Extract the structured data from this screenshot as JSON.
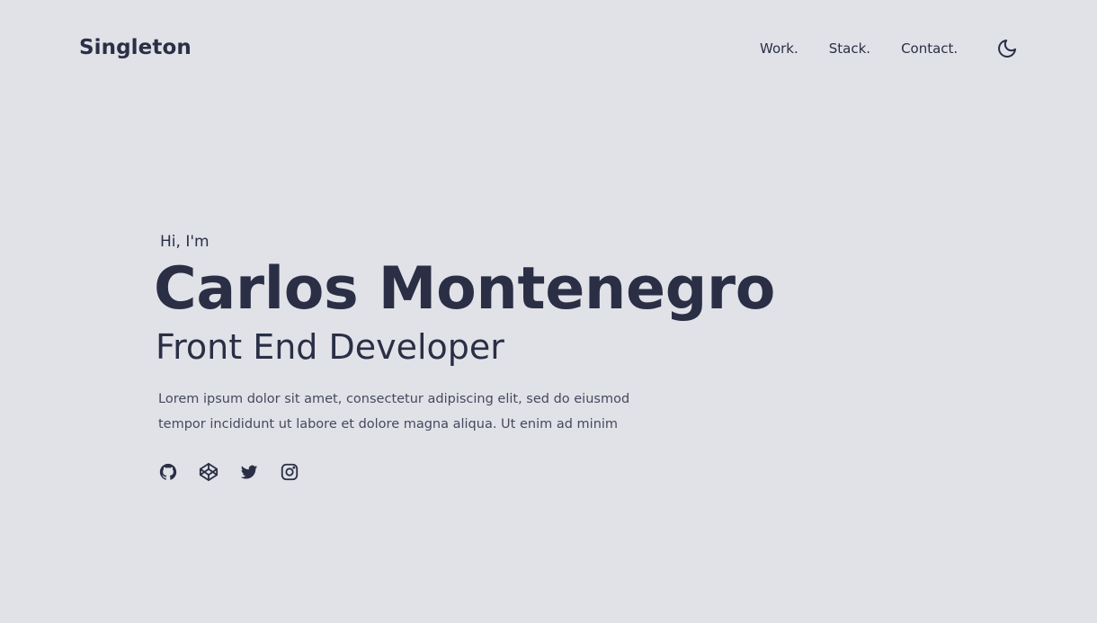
{
  "header": {
    "brand": "Singleton",
    "nav": [
      "Work.",
      "Stack.",
      "Contact."
    ],
    "theme_toggle_icon": "moon-icon"
  },
  "hero": {
    "greeting": "Hi, I'm",
    "name": "Carlos Montenegro",
    "role": "Front End Developer",
    "bio": "Lorem ipsum dolor sit amet, consectetur adipiscing elit, sed do eiusmod tempor incididunt ut labore et dolore magna aliqua. Ut enim ad minim",
    "socials": [
      "github-icon",
      "codepen-icon",
      "twitter-icon",
      "instagram-icon"
    ]
  },
  "colors": {
    "background": "#e1e2e8",
    "text": "#2a2f45"
  }
}
